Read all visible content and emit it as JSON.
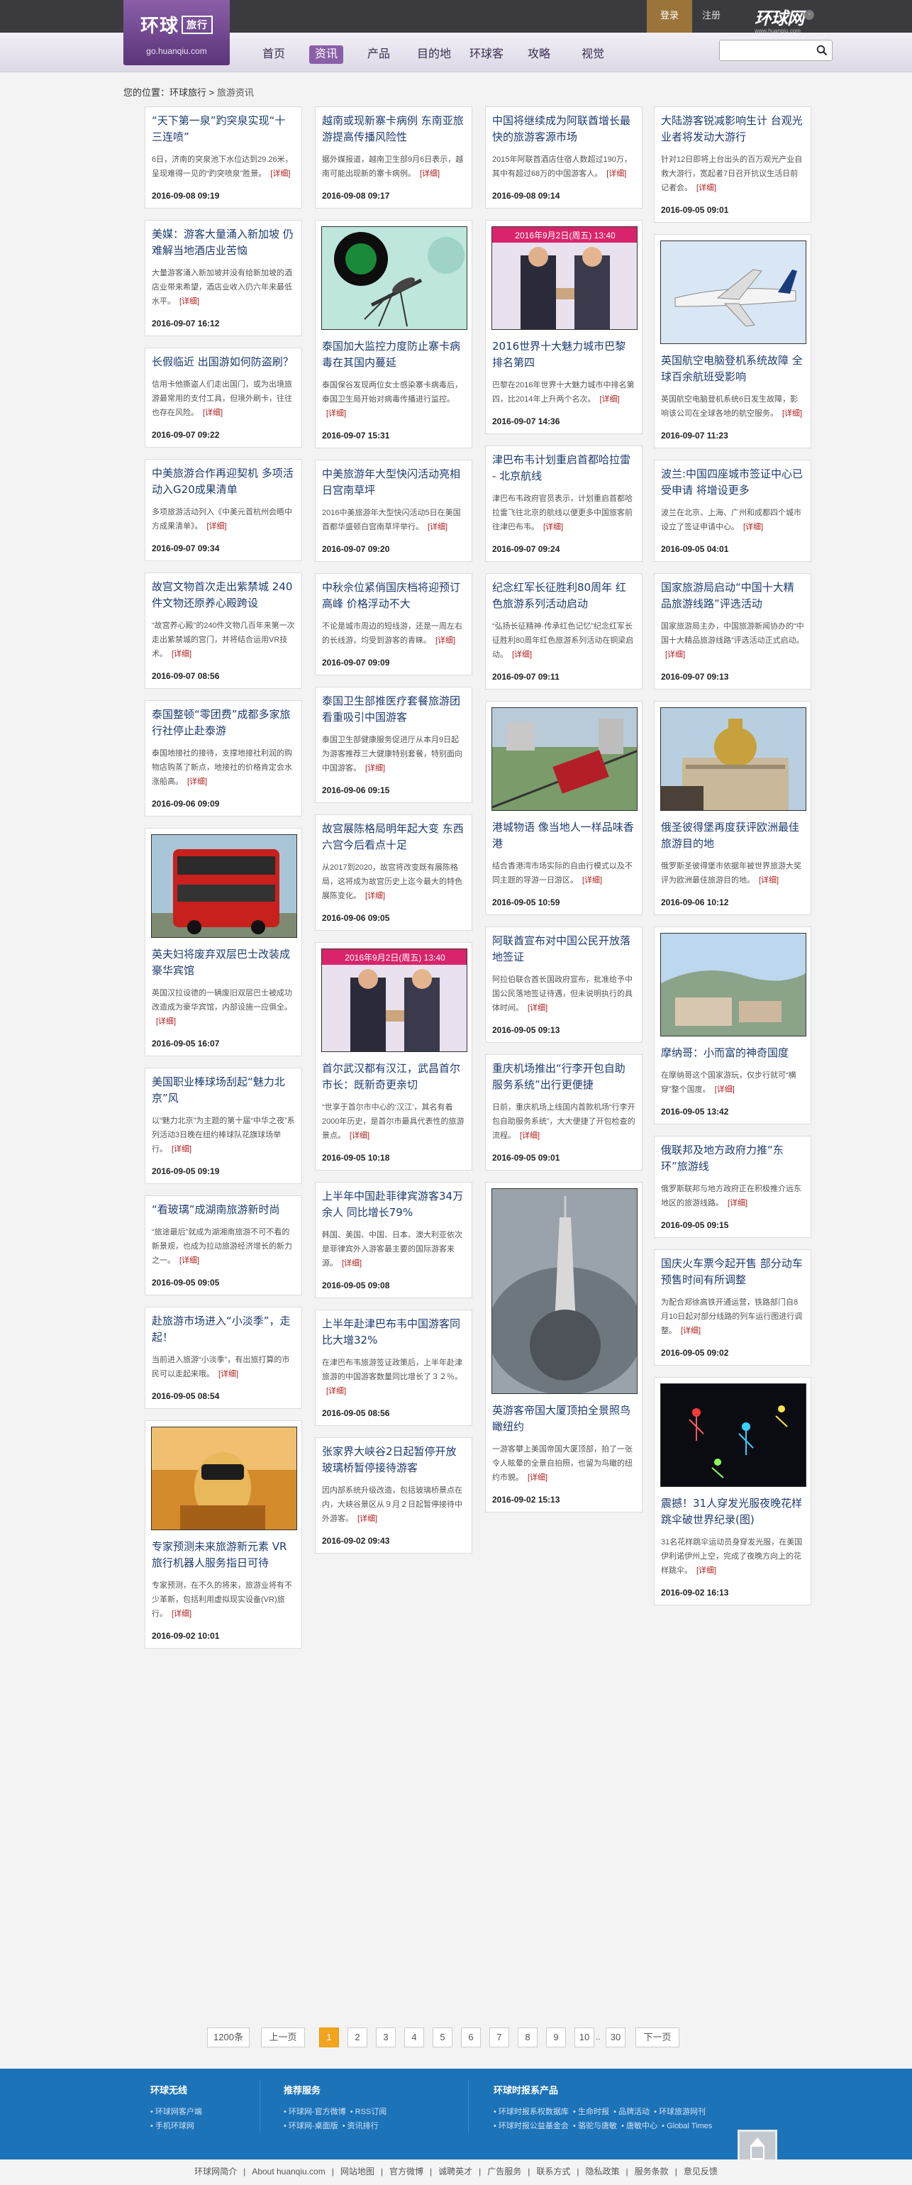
{
  "header": {
    "logo_main": "环球",
    "logo_tag": "旅行",
    "logo_url": "go.huanqiu.com",
    "login": "登录",
    "register": "注册",
    "site_logo": "环球网",
    "site_logo_sub": "www.huanqiu.com",
    "nav": [
      "首页",
      "资讯",
      "产品",
      "目的地",
      "环球客",
      "攻略",
      "视觉"
    ],
    "active_nav": "资讯",
    "search_placeholder": ""
  },
  "breadcrumb": {
    "prefix": "您的位置：",
    "home": "环球旅行",
    "sep": " > ",
    "current": "旅游资讯"
  },
  "more_label": "[详细]",
  "columns": [
    [
      {
        "title": "“天下第一泉”趵突泉实现“十三连喷”",
        "desc": "6日，济南的突泉池下水位达到29.26米，呈现难得一见的“趵突喷泉”胜景。",
        "date": "2016-09-08 09:19"
      },
      {
        "title": "美媒：游客大量涌入新加坡 仍难解当地酒店业苦恼",
        "desc": "大量游客涌入新加坡并没有给新加坡的酒店业带来希望，酒店业收入仍六年来最低水平。",
        "date": "2016-09-07 16:12"
      },
      {
        "title": "长假临近 出国游如何防盗刷？",
        "desc": "信用卡他撕盗人们走出国门，或为出境旅游最常用的支付工具，但境外刷卡，往往也存在风险。",
        "date": "2016-09-07 09:22"
      },
      {
        "title": "中美旅游合作再迎契机 多项活动入G20成果清单",
        "desc": "多项旅游活动列入《中美元首杭州会晤中方成果清单》。",
        "date": "2016-09-07 09:34"
      },
      {
        "title": "故宫文物首次走出紫禁城 240件文物还原养心殿跨设",
        "desc": "“故宫养心殿”的240件文物几百年来第一次走出紫禁城的宫门，并将结合运用VR技术。",
        "date": "2016-09-07 08:56"
      },
      {
        "title": "泰国整顿“零团费”成都多家旅行社停止赴泰游",
        "desc": "泰国地接社的接待，支撑地接社利润的购物店购蒸了新点，地接社的价格肯定会水涨船高。",
        "date": "2016-09-06 09:09"
      },
      {
        "title": "英夫妇将废弃双层巴士改装成豪华宾馆",
        "desc": "英国汉拉设德的一辆废旧双层巴士被成功改造成为豪华宾馆，内部设施一应俱全。",
        "date": "2016-09-05 16:07",
        "image": "bus"
      },
      {
        "title": "美国职业棒球场刮起“魅力北京”风",
        "desc": "以“魅力北京”为主题的第十届“中华之夜”系列活动3日晚在纽约棒球队花旗球场举行。",
        "date": "2016-09-05 09:19"
      },
      {
        "title": "“看玻璃”成湖南旅游新时尚",
        "desc": "“旅途最后”就成为湖湘南旅游不可不看的新景观，也成为拉动旅游经济增长的新力之一。",
        "date": "2016-09-05 09:05"
      },
      {
        "title": "赴旅游市场进入“小淡季”，走起！",
        "desc": "当前进入旅游“小淡季”，有出旅打算的市民可以走起来哦。",
        "date": "2016-09-05 08:54"
      },
      {
        "title": "专家预测未来旅游新元素 VR旅行机器人服务指日可待",
        "desc": "专家预测，在不久的将来，旅游业将有不少革新，包括利用虚拟现实设备(VR)旅行。",
        "date": "2016-09-02 10:01",
        "image": "vr"
      }
    ],
    [
      {
        "title": "越南或现新寨卡病例 东南亚旅游提高传播风险性",
        "desc": "据外媒报道，越南卫生部9月6日表示，越南可能出现新的寨卡病例。",
        "date": "2016-09-08 09:17"
      },
      {
        "title": "泰国加大监控力度防止寨卡病毒在其国内蔓延",
        "desc": "泰国保谷发现两位女士感染寨卡病毒后，泰国卫生局开始对病毒传播进行监控。",
        "date": "2016-09-07 15:31",
        "image": "mosquito"
      },
      {
        "title": "中美旅游年大型快闪活动亮相日宫南草坪",
        "desc": "2016中美旅游年大型快闪活动5日在美国首都华盛顿白宫南草坪举行。",
        "date": "2016-09-07 09:20"
      },
      {
        "title": "中秋佘位紧俏国庆档将迎预订高峰 价格浮动不大",
        "desc": "不论是城市周边的短线游，还是一周左右的长线游，均受到游客的青睐。",
        "date": "2016-09-07 09:09"
      },
      {
        "title": "泰国卫生部推医疗套餐旅游团 看重吸引中国游客",
        "desc": "泰国卫生部健康服务促进厅从本月9日起为游客推荐三大健康特别套餐，特别面向中国游客。",
        "date": "2016-09-06 09:15"
      },
      {
        "title": "故宫展陈格局明年起大变 东西六宫今后看点十足",
        "desc": "从2017到2020，故宫将改变既有展陈格局，这将成为故宫历史上迄今最大的特色展陈变化。",
        "date": "2016-09-06 09:05"
      },
      {
        "title": "首尔武汉都有汉江，武昌首尔市长：既新奇更亲切",
        "desc": "“世享于首尔市中心的‘汉江’，其名有着2000年历史，是首尔市最具代表性的旅游景点。",
        "date": "2016-09-05 10:18",
        "image": "handshake2"
      },
      {
        "title": "上半年中国赴菲律宾游客34万余人 同比增长79%",
        "desc": "韩国、美国、中国、日本、澳大利亚依次是菲律宾外入游客最主要的国际游客来源。",
        "date": "2016-09-05 09:08"
      },
      {
        "title": "上半年赴津巴布韦中国游客同比大增32%",
        "desc": "在津巴布韦旅游签证政策后，上半年赴津旅游的中国游客数量同比增长了３２％。",
        "date": "2016-09-05 08:56"
      },
      {
        "title": "张家界大峡谷2日起暂停开放玻璃桥暂停接待游客",
        "desc": "因内部系统升级改造，包括玻璃桥景点在内，大峡谷景区从９月２日起暂停接待中外游客。",
        "date": "2016-09-02 09:43"
      }
    ],
    [
      {
        "title": "中国将继续成为阿联酋增长最快的旅游客源市场",
        "desc": "2015年阿联酋酒店住宿人数超过190万，其中有超过68万的中国游客人。",
        "date": "2016-09-08 09:14"
      },
      {
        "title": "2016世界十大魅力城市巴黎排名第四",
        "desc": "巴黎在2016年世界十大魅力城市中排名第四，比2014年上升两个名次。",
        "date": "2016-09-07 14:36",
        "image": "handshake1",
        "banner": "2016年9月2日(周五) 13:40"
      },
      {
        "title": "津巴布韦计划重启首都哈拉雷 - 北京航线",
        "desc": "津巴布韦政府官员表示，计划重启首都哈拉雷飞往北京的航线以便更多中国旅客前往津巴布韦。",
        "date": "2016-09-07 09:24"
      },
      {
        "title": "纪念红军长征胜利80周年 红色旅游系列活动启动",
        "desc": "“弘扬长征精神·传承红色记忆”纪念红军长征胜利80周年红色旅游系列活动在铜梁启动。",
        "date": "2016-09-07 09:11"
      },
      {
        "title": "港城物语 像当地人一样品味香港",
        "desc": "结合香港湾市场实际的自由行模式以及不同主题的导游一日游区。",
        "date": "2016-09-05 10:59",
        "image": "tram"
      },
      {
        "title": "阿联酋宣布对中国公民开放落地签证",
        "desc": "阿拉伯联合酋长国政府宣布，批准给予中国公民落地签证待遇，但未说明执行的具体时间。",
        "date": "2016-09-05 09:13"
      },
      {
        "title": "重庆机场推出“行李开包自助服务系统”出行更便捷",
        "desc": "日前，重庆机场上线国内首款机场“行李开包自助服务系统”，大大便捷了开包检查的流程。",
        "date": "2016-09-05 09:01"
      },
      {
        "title": "英游客帝国大厦顶拍全景照鸟瞰纽约",
        "desc": "一游客攀上美国帝国大厦顶部，拍了一张令人眩晕的全景自拍照，也留为鸟瞰的纽约市貌。",
        "date": "2016-09-02 15:13",
        "image": "tower"
      }
    ],
    [
      {
        "title": "大陆游客锐减影响生计 台观光业者将发动大游行",
        "desc": "针对12日即将上台出头的百万观光产业自救大游行，宽起者7日召开抗议生活日前记者会。",
        "date": "2016-09-05 09:01"
      },
      {
        "title": "英国航空电脑登机系统故障 全球百余航班受影响",
        "desc": "英国航空电脑登机系统6日发生故障，影响该公司在全球各地的航空服务。",
        "date": "2016-09-07 11:23",
        "image": "plane"
      },
      {
        "title": "波兰:中国四座城市签证中心已受申请 将增设更多",
        "desc": "波兰在北京、上海、广州和成都四个城市设立了签证申请中心。",
        "date": "2016-09-05 04:01"
      },
      {
        "title": "国家旅游局启动“中国十大精品旅游线路”评选活动",
        "desc": "国家旅游局主办，中国旅游新闻协办的“中国十大精品旅游线路”评选活动正式启动。",
        "date": "2016-09-07 09:13"
      },
      {
        "title": "俄圣彼得堡再度获评欧洲最佳旅游目的地",
        "desc": "俄罗斯圣彼得堡市依据年被世界旅游大奖评为欧洲最佳旅游目的地。",
        "date": "2016-09-06 10:12",
        "image": "church"
      },
      {
        "title": "摩纳哥：小而富的神奇国度",
        "desc": "在摩纳哥这个国家游玩，仅步行就可“横穿”整个国度。",
        "date": "2016-09-05 13:42",
        "image": "monaco"
      },
      {
        "title": "俄联邦及地方政府力推“东环”旅游线",
        "desc": "俄罗斯联邦与地方政府正在积极推介远东地区的旅游线路。",
        "date": "2016-09-05 09:15"
      },
      {
        "title": "国庆火车票今起开售 部分动车预售时间有所调整",
        "desc": "为配合郑徐高铁开通运营，铁路部门自8月10日起对部分线路的列车运行图进行调整。",
        "date": "2016-09-05 09:02"
      },
      {
        "title": "震撼！31人穿发光服夜晚花样跳伞破世界纪录(图)",
        "desc": "31名花样跳伞运动员身穿发光服，在美国伊利诺伊州上空，完成了夜晚方向上的花样跳伞。",
        "date": "2016-09-02 16:13",
        "image": "skydive"
      }
    ]
  ],
  "pagination": {
    "total": "1200条",
    "prev": "上一页",
    "pages": [
      "1",
      "2",
      "3",
      "4",
      "5",
      "6",
      "7",
      "8",
      "9",
      "10"
    ],
    "dots": "..",
    "last": "30",
    "next": "下一页",
    "current": "1"
  },
  "footer": {
    "col1": {
      "title": "环球无线",
      "links": [
        "环球网客户端",
        "手机环球网"
      ]
    },
    "col2": {
      "title": "推荐服务",
      "links": [
        "环球网-官方微博",
        "RSS订阅",
        "环球网-桌面版",
        "资讯排行"
      ]
    },
    "col3": {
      "title": "环球时报系产品",
      "links": [
        "环球时报系权数据库",
        "生命时报",
        "品牌活动",
        "环球旅游网刊",
        "环球时报公益基金会",
        "骆驼与唐敏",
        "唐敏中心",
        "Global Times"
      ]
    }
  },
  "bottom_links": [
    "环球网简介",
    "About huanqiu.com",
    "网站地图",
    "官方微博",
    "诚聘英才",
    "广告服务",
    "联系方式",
    "隐私政策",
    "服务条款",
    "意见反馈"
  ],
  "colors": {
    "purple": "#8a5fa8",
    "footer_blue": "#1d73b8",
    "title_blue": "#1e3b6e",
    "more_red": "#b01c1c",
    "page_active": "#f3a41f"
  }
}
